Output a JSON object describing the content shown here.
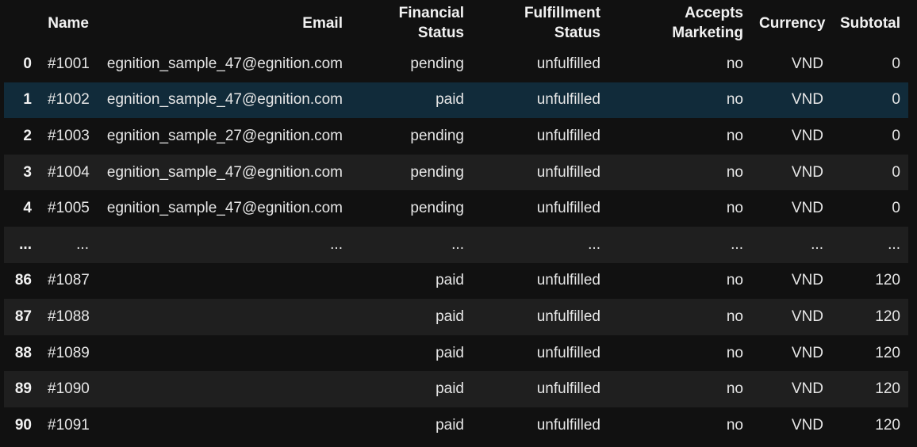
{
  "table": {
    "columns": [
      "",
      "Name",
      "Email",
      "Financial Status",
      "Fulfillment Status",
      "Accepts Marketing",
      "Currency",
      "Subtotal"
    ],
    "header_lines": [
      [
        ""
      ],
      [
        "Name"
      ],
      [
        "Email"
      ],
      [
        "Financial",
        "Status"
      ],
      [
        "Fulfillment",
        "Status"
      ],
      [
        "Accepts",
        "Marketing"
      ],
      [
        "Currency"
      ],
      [
        "Subtotal"
      ]
    ],
    "rows": [
      {
        "index": "0",
        "name": "#1001",
        "email": "egnition_sample_47@egnition.com",
        "financial_status": "pending",
        "fulfillment_status": "unfulfilled",
        "accepts_marketing": "no",
        "currency": "VND",
        "subtotal": "0",
        "style": "odd"
      },
      {
        "index": "1",
        "name": "#1002",
        "email": "egnition_sample_47@egnition.com",
        "financial_status": "paid",
        "fulfillment_status": "unfulfilled",
        "accepts_marketing": "no",
        "currency": "VND",
        "subtotal": "0",
        "style": "hover"
      },
      {
        "index": "2",
        "name": "#1003",
        "email": "egnition_sample_27@egnition.com",
        "financial_status": "pending",
        "fulfillment_status": "unfulfilled",
        "accepts_marketing": "no",
        "currency": "VND",
        "subtotal": "0",
        "style": "odd"
      },
      {
        "index": "3",
        "name": "#1004",
        "email": "egnition_sample_47@egnition.com",
        "financial_status": "pending",
        "fulfillment_status": "unfulfilled",
        "accepts_marketing": "no",
        "currency": "VND",
        "subtotal": "0",
        "style": "even"
      },
      {
        "index": "4",
        "name": "#1005",
        "email": "egnition_sample_47@egnition.com",
        "financial_status": "pending",
        "fulfillment_status": "unfulfilled",
        "accepts_marketing": "no",
        "currency": "VND",
        "subtotal": "0",
        "style": "odd"
      },
      {
        "index": "...",
        "name": "...",
        "email": "...",
        "financial_status": "...",
        "fulfillment_status": "...",
        "accepts_marketing": "...",
        "currency": "...",
        "subtotal": "...",
        "style": "even"
      },
      {
        "index": "86",
        "name": "#1087",
        "email": "",
        "financial_status": "paid",
        "fulfillment_status": "unfulfilled",
        "accepts_marketing": "no",
        "currency": "VND",
        "subtotal": "120",
        "style": "odd"
      },
      {
        "index": "87",
        "name": "#1088",
        "email": "",
        "financial_status": "paid",
        "fulfillment_status": "unfulfilled",
        "accepts_marketing": "no",
        "currency": "VND",
        "subtotal": "120",
        "style": "even"
      },
      {
        "index": "88",
        "name": "#1089",
        "email": "",
        "financial_status": "paid",
        "fulfillment_status": "unfulfilled",
        "accepts_marketing": "no",
        "currency": "VND",
        "subtotal": "120",
        "style": "odd"
      },
      {
        "index": "89",
        "name": "#1090",
        "email": "",
        "financial_status": "paid",
        "fulfillment_status": "unfulfilled",
        "accepts_marketing": "no",
        "currency": "VND",
        "subtotal": "120",
        "style": "even"
      },
      {
        "index": "90",
        "name": "#1091",
        "email": "",
        "financial_status": "paid",
        "fulfillment_status": "unfulfilled",
        "accepts_marketing": "no",
        "currency": "VND",
        "subtotal": "120",
        "style": "odd"
      }
    ]
  },
  "colors": {
    "background": "#111111",
    "row_alt": "#1f1f1f",
    "row_hover": "#112b3a",
    "text": "#e6e6e6"
  }
}
